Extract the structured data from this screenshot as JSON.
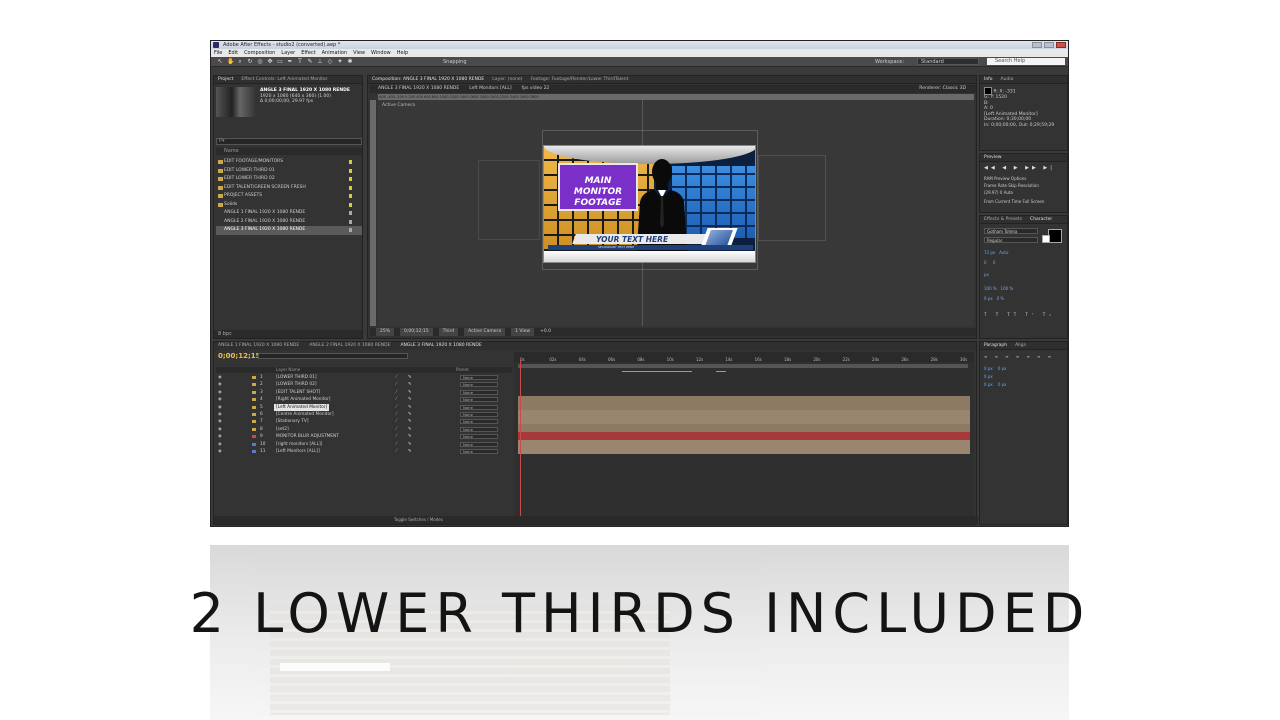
{
  "window": {
    "title": "Adobe After Effects - studio2 (converted).aep *"
  },
  "menu": [
    "File",
    "Edit",
    "Composition",
    "Layer",
    "Effect",
    "Animation",
    "View",
    "Window",
    "Help"
  ],
  "toolbar": {
    "snapping_label": "Snapping",
    "workspace_label": "Workspace:",
    "workspace_value": "Standard",
    "search_placeholder": "Search Help"
  },
  "project": {
    "tabs": [
      "Project",
      "Effect Controls: Left Animated Monitor"
    ],
    "thumb": {
      "name": "ANGLE 3 FINAL 1920 X 1080 RENDE",
      "size": "1920 x 1080 (640 x 360) (1.00)",
      "duration": "Δ 0;00;00;00, 29.97 fps"
    },
    "search_value": "P▾",
    "col_name": "Name",
    "items": [
      {
        "label": "EDIT FOOTAGE/MONITORS",
        "folder": true,
        "swatch": "yellow"
      },
      {
        "label": "EDIT LOWER THIRD 01",
        "folder": true,
        "swatch": "yellow"
      },
      {
        "label": "EDIT LOWER THIRD 02",
        "folder": true,
        "swatch": "yellow"
      },
      {
        "label": "EDIT TALENT/GREEN SCREEN FRESH",
        "folder": true,
        "swatch": "yellow"
      },
      {
        "label": "PROJECT ASSETS",
        "folder": true,
        "swatch": "yellow"
      },
      {
        "label": "Solids",
        "folder": true,
        "swatch": "yellow"
      },
      {
        "label": "ANGLE 1 FINAL 1920 X 1080 RENDE",
        "folder": false,
        "swatch": "gray"
      },
      {
        "label": "ANGLE 2 FINAL 1920 X 1080 RENDE",
        "folder": false,
        "swatch": "gray"
      },
      {
        "label": "ANGLE 3 FINAL 1920 X 1080 RENDE",
        "folder": false,
        "swatch": "gray",
        "selected": true
      }
    ],
    "bottom_bpc": "8 bpc"
  },
  "composition": {
    "tabs": [
      "Composition: ANGLE 3 FINAL 1920 X 1080 RENDE",
      "Layer: (none)",
      "Footage: Footage/Render/Lower ThirdTalent"
    ],
    "sub_tabs": [
      "ANGLE 3 FINAL 1920 X 1080 RENDE",
      "Left Monitors [ALL]",
      "fps video 22"
    ],
    "renderer_label": "Renderer:",
    "renderer_value": "Classic 3D",
    "view_label": "Active Camera",
    "ruler": "-600 -400 -200 0 200 400 600 800 1000 1200 1400 1600 1800 2000 2200 2400 2600 2800",
    "monitor_text_1": "MAIN MONITOR",
    "monitor_text_2": "FOOTAGE",
    "lower_third_text": "YOUR TEXT HERE",
    "lower_third_sub": "SECONDARY TEXT HERE",
    "bottom": {
      "zoom": "25%",
      "timecode": "0;00;12;15",
      "resolution": "Third",
      "camera": "Active Camera",
      "views": "1 View",
      "offset": "+0.0"
    }
  },
  "info_panel": {
    "tabs": [
      "Info",
      "Audio"
    ],
    "r": "R:",
    "g": "G:",
    "b": "B:",
    "a": "A: 0",
    "x": "X: -331",
    "y": "Y: 1520",
    "layer": "[Left Animated Monitor]",
    "duration": "Duration: 0;30;00;00",
    "in_out": "In: 0;00;00;00, Out: 0;29;59;29"
  },
  "preview_panel": {
    "tab": "Preview",
    "controls": "◀◀ ◀ ▶ ▶▶ ▶|",
    "ram_options": "RAM Preview Options",
    "frame_rate_label": "Frame Rate",
    "skip_label": "Skip",
    "resolution_label": "Resolution",
    "frame_rate": "(29.97)",
    "skip": "0",
    "resolution": "Auto",
    "from_current": "From Current Time",
    "full_screen": "Full Screen"
  },
  "character_panel": {
    "tabs": [
      "Effects & Presets",
      "Character"
    ],
    "font": "Gotham Tohma",
    "style": "Regular",
    "size": "72 px",
    "leading": "Auto",
    "kerning": "0",
    "tracking": "0",
    "stroke": "px",
    "vscale": "100 %",
    "hscale": "100 %",
    "baseline": "0 px",
    "tsume": "0 %"
  },
  "timeline": {
    "tabs": [
      "ANGLE 1 FINAL 1920 X 1080 RENDE",
      "ANGLE 2 FINAL 1920 X 1080 RENDE",
      "ANGLE 3 FINAL 1920 X 1080 RENDE"
    ],
    "timecode": "0;00;12;15",
    "col_layer_name": "Layer Name",
    "col_parent": "Parent",
    "layers": [
      {
        "num": "1",
        "name": "[LOWER THIRD 01]",
        "color": "yellow",
        "parent": "None"
      },
      {
        "num": "2",
        "name": "[LOWER THIRD 02]",
        "color": "yellow",
        "parent": "None"
      },
      {
        "num": "3",
        "name": "[EDIT TALENT SHOT]",
        "color": "yellow",
        "parent": "None"
      },
      {
        "num": "4",
        "name": "[Right Animated Monitor]",
        "color": "yellow",
        "parent": "None"
      },
      {
        "num": "5",
        "name": "[Left Animated Monitor]",
        "color": "yellow",
        "parent": "None",
        "selected": true
      },
      {
        "num": "6",
        "name": "[Centre Animated Monitor]",
        "color": "yellow",
        "parent": "None"
      },
      {
        "num": "7",
        "name": "[Stationary TV]",
        "color": "yellow",
        "parent": "None"
      },
      {
        "num": "8",
        "name": "[set2]",
        "color": "yellow",
        "parent": "None"
      },
      {
        "num": "9",
        "name": "MONITOR BLUR ADJUSTMENT",
        "color": "red",
        "parent": "None"
      },
      {
        "num": "10",
        "name": "[right monitors [ALL]]",
        "color": "blue",
        "parent": "None"
      },
      {
        "num": "11",
        "name": "[Left Monitors [ALL]]",
        "color": "blue",
        "parent": "None"
      }
    ],
    "ruler_marks": [
      "0s",
      "02s",
      "04s",
      "06s",
      "08s",
      "10s",
      "12s",
      "14s",
      "16s",
      "18s",
      "20s",
      "22s",
      "24s",
      "26s",
      "28s",
      "30s"
    ],
    "bottom_mode": "Toggle Switches / Modes"
  },
  "paragraph_panel": {
    "tabs": [
      "Paragraph",
      "Align"
    ],
    "indent_left": "0 px",
    "indent_right": "0 px",
    "indent_first": "0 px",
    "space_before": "0 px",
    "space_after": "0 px"
  },
  "caption": "2 LOWER THIRDS INCLUDED"
}
